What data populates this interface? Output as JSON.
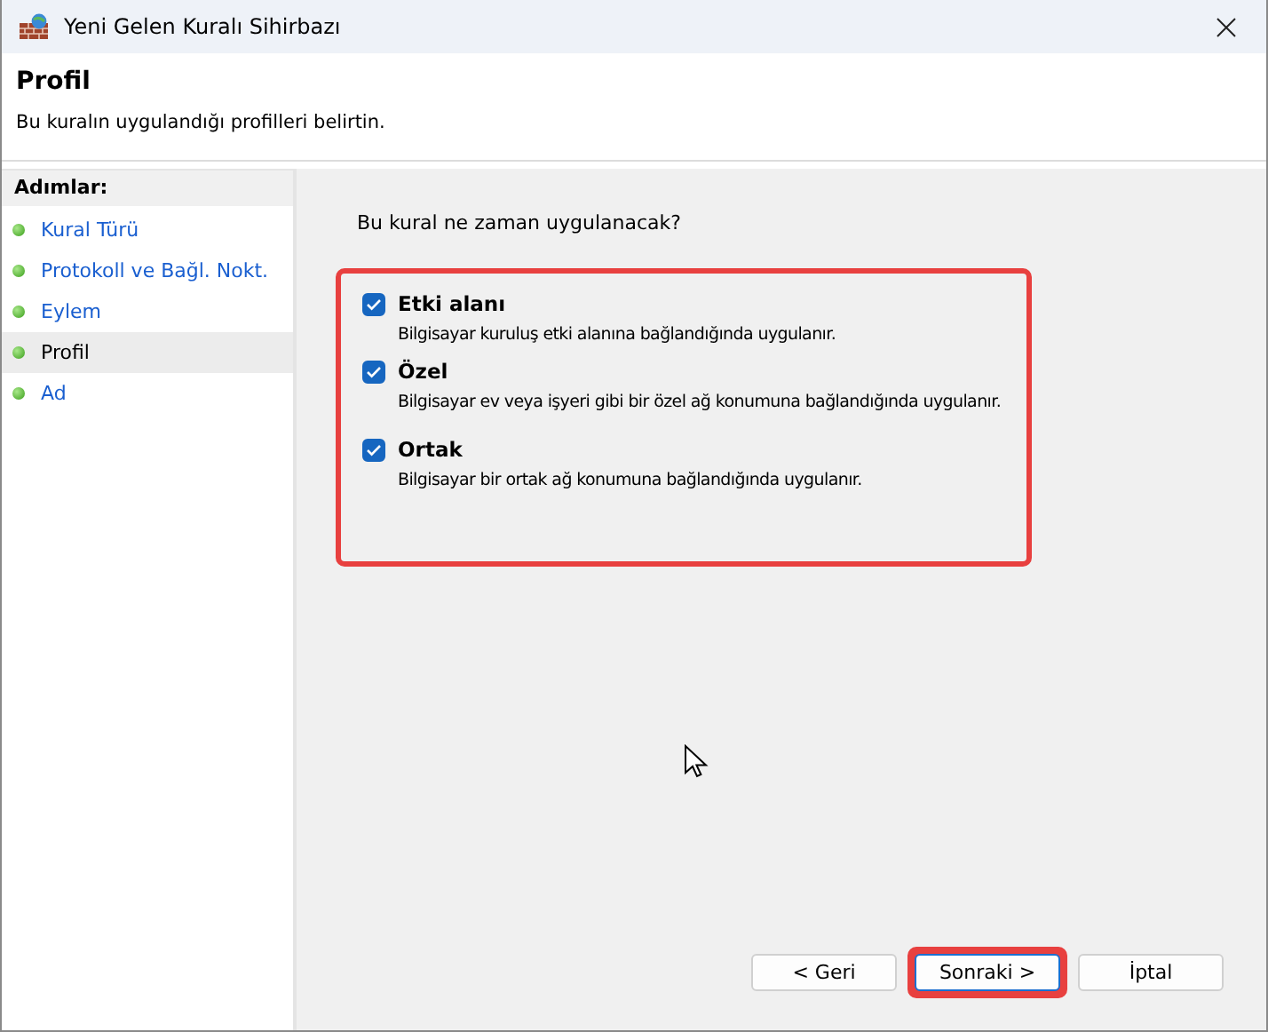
{
  "window": {
    "title": "Yeni Gelen Kuralı Sihirbazı"
  },
  "header": {
    "title": "Profil",
    "subtitle": "Bu kuralın uygulandığı profilleri belirtin."
  },
  "steps": {
    "heading": "Adımlar:",
    "items": [
      {
        "label": "Kural Türü",
        "selected": false
      },
      {
        "label": "Protokoll ve Bağl. Nokt.",
        "selected": false
      },
      {
        "label": "Eylem",
        "selected": false
      },
      {
        "label": "Profil",
        "selected": true
      },
      {
        "label": "Ad",
        "selected": false
      }
    ]
  },
  "question": "Bu kural ne zaman uygulanacak?",
  "options_highlighted": true,
  "options": [
    {
      "label": "Etki alanı",
      "description": "Bilgisayar kuruluş etki alanına bağlandığında uygulanır.",
      "checked": true
    },
    {
      "label": "Özel",
      "description": "Bilgisayar ev veya işyeri gibi bir özel ağ konumuna bağlandığında uygulanır.",
      "checked": true
    },
    {
      "label": "Ortak",
      "description": "Bilgisayar bir ortak ağ konumuna bağlandığında uygulanır.",
      "checked": true
    }
  ],
  "buttons": [
    {
      "label": "< Geri",
      "default": false,
      "highlighted": false
    },
    {
      "label": "Sonraki >",
      "default": true,
      "highlighted": true
    },
    {
      "label": "İptal",
      "default": false,
      "highlighted": false
    }
  ]
}
